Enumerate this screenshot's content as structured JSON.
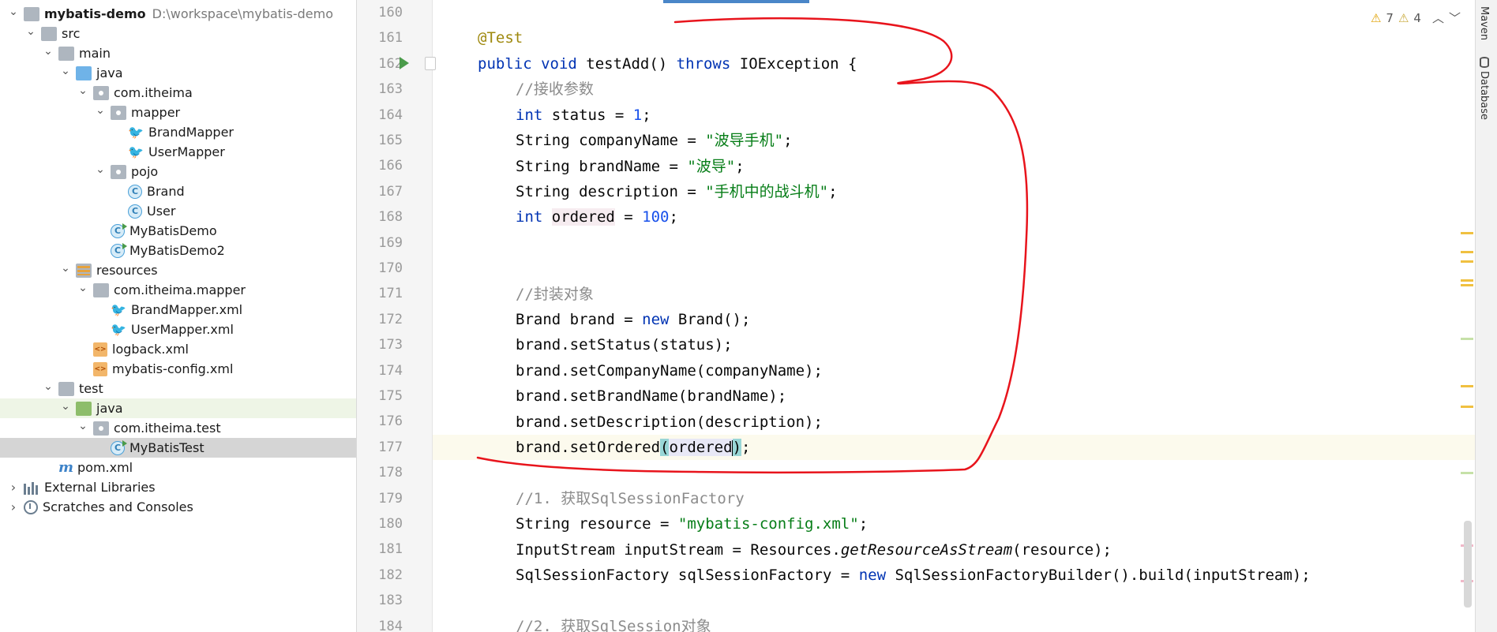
{
  "project_tree": [
    {
      "label": "mybatis-demo",
      "path": "D:\\workspace\\mybatis-demo",
      "icon": "folder",
      "level": 0,
      "expanded": true,
      "bold": true
    },
    {
      "label": "src",
      "icon": "folder",
      "level": 1,
      "expanded": true
    },
    {
      "label": "main",
      "icon": "folder",
      "level": 2,
      "expanded": true
    },
    {
      "label": "java",
      "icon": "folder-blue",
      "level": 3,
      "expanded": true
    },
    {
      "label": "com.itheima",
      "icon": "package",
      "level": 4,
      "expanded": true
    },
    {
      "label": "mapper",
      "icon": "package",
      "level": 5,
      "expanded": true
    },
    {
      "label": "BrandMapper",
      "icon": "mybatis-mapper",
      "level": 6
    },
    {
      "label": "UserMapper",
      "icon": "mybatis-mapper",
      "level": 6
    },
    {
      "label": "pojo",
      "icon": "package",
      "level": 5,
      "expanded": true
    },
    {
      "label": "Brand",
      "icon": "class",
      "level": 6
    },
    {
      "label": "User",
      "icon": "class",
      "level": 6
    },
    {
      "label": "MyBatisDemo",
      "icon": "class-runnable",
      "level": 5
    },
    {
      "label": "MyBatisDemo2",
      "icon": "class-runnable",
      "level": 5
    },
    {
      "label": "resources",
      "icon": "resources-folder",
      "level": 3,
      "expanded": true
    },
    {
      "label": "com.itheima.mapper",
      "icon": "folder",
      "level": 4,
      "expanded": true
    },
    {
      "label": "BrandMapper.xml",
      "icon": "mybatis-xml",
      "level": 5
    },
    {
      "label": "UserMapper.xml",
      "icon": "mybatis-xml",
      "level": 5
    },
    {
      "label": "logback.xml",
      "icon": "xml",
      "level": 4
    },
    {
      "label": "mybatis-config.xml",
      "icon": "xml",
      "level": 4
    },
    {
      "label": "test",
      "icon": "folder",
      "level": 2,
      "expanded": true
    },
    {
      "label": "java",
      "icon": "folder-green",
      "level": 3,
      "expanded": true,
      "highlight": "green"
    },
    {
      "label": "com.itheima.test",
      "icon": "package",
      "level": 4,
      "expanded": true
    },
    {
      "label": "MyBatisTest",
      "icon": "class-runnable",
      "level": 5,
      "highlight": "selected"
    },
    {
      "label": "pom.xml",
      "icon": "maven",
      "level": 2
    },
    {
      "label": "External Libraries",
      "icon": "libraries",
      "level": 0,
      "expanded": false
    },
    {
      "label": "Scratches and Consoles",
      "icon": "scratches",
      "level": 0,
      "expanded": false
    }
  ],
  "editor": {
    "line_numbers": [
      "160",
      "161",
      "162",
      "163",
      "164",
      "165",
      "166",
      "167",
      "168",
      "169",
      "170",
      "171",
      "172",
      "173",
      "174",
      "175",
      "176",
      "177",
      "178",
      "179",
      "180",
      "181",
      "182",
      "183",
      "184"
    ],
    "inspections": {
      "warnings": "7",
      "weak_warnings": "4"
    },
    "code": {
      "annotation": "@Test",
      "l162_kw1": "public ",
      "l162_kw2": "void ",
      "l162_name": "testAdd() ",
      "l162_kw3": "throws ",
      "l162_rest": "IOException {",
      "c163": "//接收参数",
      "l164_kw": "int ",
      "l164_mid": "status = ",
      "l164_num": "1",
      "l164_end": ";",
      "l165_a": "String companyName = ",
      "l165_str": "\"波导手机\"",
      "l165_end": ";",
      "l166_a": "String brandName = ",
      "l166_str": "\"波导\"",
      "l166_end": ";",
      "l167_a": "String description = ",
      "l167_str": "\"手机中的战斗机\"",
      "l167_end": ";",
      "l168_kw": "int ",
      "l168_var": "ordered",
      "l168_mid": " = ",
      "l168_num": "100",
      "l168_end": ";",
      "c171": "//封装对象",
      "l172_a": "Brand brand = ",
      "l172_kw": "new ",
      "l172_b": "Brand();",
      "l173": "brand.setStatus(status);",
      "l174": "brand.setCompanyName(companyName);",
      "l175": "brand.setBrandName(brandName);",
      "l176": "brand.setDescription(description);",
      "l177_a": "brand.setOrdered",
      "l177_open": "(",
      "l177_arg": "ordered",
      "l177_close": ")",
      "l177_end": ";",
      "c179": "//1. 获取SqlSessionFactory",
      "l180_a": "String resource = ",
      "l180_str": "\"mybatis-config.xml\"",
      "l180_end": ";",
      "l181_a": "InputStream inputStream = Resources.",
      "l181_it": "getResourceAsStream",
      "l181_b": "(resource);",
      "l182_a": "SqlSessionFactory sqlSessionFactory = ",
      "l182_kw": "new ",
      "l182_b": "SqlSessionFactoryBuilder().build(inputStream);",
      "c184": "//2. 获取SqlSession对象"
    }
  },
  "right_tools": {
    "maven": "Maven",
    "database": "Database"
  },
  "colors": {
    "keyword": "#0033b3",
    "number": "#1750eb",
    "string": "#067d17",
    "comment": "#8c8c8c",
    "annotation": "#9e880d",
    "pen": "#e8141c"
  }
}
